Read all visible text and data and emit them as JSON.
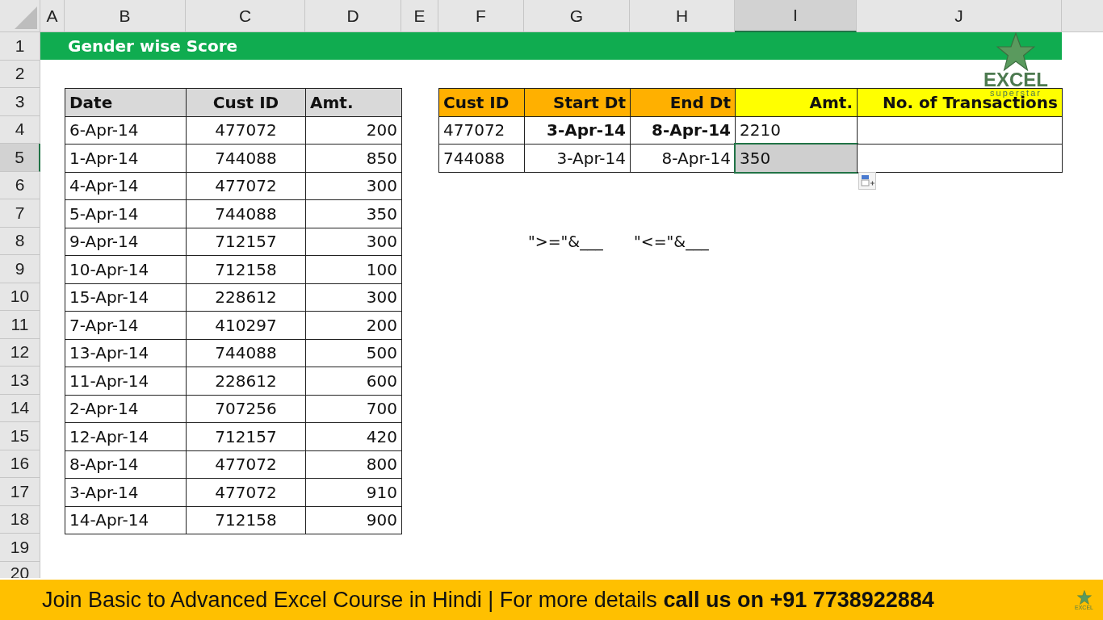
{
  "columns": [
    {
      "label": "A",
      "selected": false
    },
    {
      "label": "B",
      "selected": false
    },
    {
      "label": "C",
      "selected": false
    },
    {
      "label": "D",
      "selected": false
    },
    {
      "label": "E",
      "selected": false
    },
    {
      "label": "F",
      "selected": false
    },
    {
      "label": "G",
      "selected": false
    },
    {
      "label": "H",
      "selected": false
    },
    {
      "label": "I",
      "selected": true
    },
    {
      "label": "J",
      "selected": false
    }
  ],
  "rows": [
    {
      "label": "1",
      "selected": false
    },
    {
      "label": "2",
      "selected": false
    },
    {
      "label": "3",
      "selected": false
    },
    {
      "label": "4",
      "selected": false
    },
    {
      "label": "5",
      "selected": true
    },
    {
      "label": "6",
      "selected": false
    },
    {
      "label": "7",
      "selected": false
    },
    {
      "label": "8",
      "selected": false
    },
    {
      "label": "9",
      "selected": false
    },
    {
      "label": "10",
      "selected": false
    },
    {
      "label": "11",
      "selected": false
    },
    {
      "label": "12",
      "selected": false
    },
    {
      "label": "13",
      "selected": false
    },
    {
      "label": "14",
      "selected": false
    },
    {
      "label": "15",
      "selected": false
    },
    {
      "label": "16",
      "selected": false
    },
    {
      "label": "17",
      "selected": false
    },
    {
      "label": "18",
      "selected": false
    },
    {
      "label": "19",
      "selected": false
    },
    {
      "label": "20",
      "selected": false
    }
  ],
  "title": "Gender wise Score",
  "logo": {
    "title": "EXCEL",
    "subtitle": "superstar"
  },
  "left_table": {
    "headers": [
      "Date",
      "Cust ID",
      "Amt."
    ],
    "rows": [
      [
        "6-Apr-14",
        "477072",
        "200"
      ],
      [
        "1-Apr-14",
        "744088",
        "850"
      ],
      [
        "4-Apr-14",
        "477072",
        "300"
      ],
      [
        "5-Apr-14",
        "744088",
        "350"
      ],
      [
        "9-Apr-14",
        "712157",
        "300"
      ],
      [
        "10-Apr-14",
        "712158",
        "100"
      ],
      [
        "15-Apr-14",
        "228612",
        "300"
      ],
      [
        "7-Apr-14",
        "410297",
        "200"
      ],
      [
        "13-Apr-14",
        "744088",
        "500"
      ],
      [
        "11-Apr-14",
        "228612",
        "600"
      ],
      [
        "2-Apr-14",
        "707256",
        "700"
      ],
      [
        "12-Apr-14",
        "712157",
        "420"
      ],
      [
        "8-Apr-14",
        "477072",
        "800"
      ],
      [
        "3-Apr-14",
        "477072",
        "910"
      ],
      [
        "14-Apr-14",
        "712158",
        "900"
      ]
    ]
  },
  "right_table": {
    "headers": [
      {
        "label": "Cust ID",
        "color": "#ffb000"
      },
      {
        "label": "Start Dt",
        "color": "#ffb000"
      },
      {
        "label": "End Dt",
        "color": "#ffb000"
      },
      {
        "label": "Amt.",
        "color": "#ffff00"
      },
      {
        "label": "No. of Transactions",
        "color": "#ffff00"
      }
    ],
    "rows": [
      [
        {
          "text": "477072",
          "bold": false,
          "selected": false
        },
        {
          "text": "3-Apr-14",
          "bold": true,
          "selected": false
        },
        {
          "text": "8-Apr-14",
          "bold": true,
          "selected": false
        },
        {
          "text": "2210",
          "bold": false,
          "selected": false
        },
        {
          "selected": false
        }
      ],
      [
        {
          "text": "744088",
          "bold": false,
          "selected": false
        },
        {
          "text": "3-Apr-14",
          "bold": false,
          "selected": false
        },
        {
          "text": "8-Apr-14",
          "bold": false,
          "selected": false
        },
        {
          "text": "350",
          "bold": false,
          "selected": true
        },
        {
          "selected": false
        }
      ]
    ]
  },
  "notes": [
    "\">=\"&___",
    "\"<=\"&___"
  ],
  "banner": {
    "text": "Join Basic to Advanced Excel Course in Hindi | For more details **call us on +91 7738922884**",
    "logo": "EXCEL"
  }
}
